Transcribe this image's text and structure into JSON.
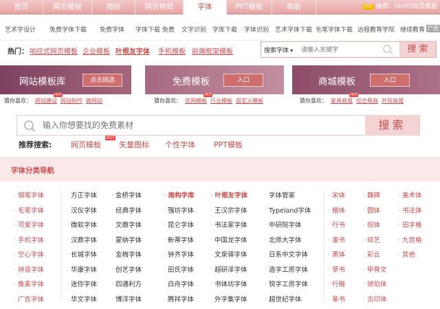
{
  "topnav": {
    "tabs": [
      "首页",
      "网页模板",
      "图标",
      "网页特效",
      "字体",
      "PPT模板",
      "帮助"
    ],
    "active": 4,
    "right_text": "推荐：html5网页模板",
    "right_hot": "HOT"
  },
  "subnav": {
    "items": [
      "艺术字设计",
      "免费字体下载",
      "免费字体",
      "字体下载 免费",
      "文字识别",
      "字库下载",
      "字体识别",
      "艺术字体下载",
      "毛笔字体下载",
      "远程教育学院",
      "继续教育"
    ],
    "ad": "广告"
  },
  "hotbar": {
    "label": "热门：",
    "links": [
      "响应式网页模板",
      "企业模板",
      "叶根友字体",
      "手机模板",
      "前端框架模板"
    ],
    "search_select": "搜索字体",
    "search_placeholder": "请输入关键字",
    "search_button": "搜 索"
  },
  "banners": [
    {
      "title": "网站模板库",
      "button": "点击挑选",
      "guess_label": "猜你喜欢：",
      "guess_links": [
        "网站建设",
        "网站制作",
        "做网站"
      ]
    },
    {
      "title": "免费模板",
      "button": "入口",
      "guess_label": "猜你喜欢：",
      "guess_links": [
        "官网模板",
        "行业模板",
        "自定义模板"
      ]
    },
    {
      "title": "商城模板",
      "button": "入口",
      "guess_label": "猜你喜欢：",
      "guess_links": [
        "家具商城",
        "综合电商",
        "外贸商城"
      ]
    }
  ],
  "big_search": {
    "placeholder": "输入你想要找的免费素材",
    "button": "搜索"
  },
  "recommend": {
    "label": "推荐搜索:",
    "links": [
      "网页模板",
      "矢量图标",
      "个性字体",
      "PPT模板"
    ],
    "hot": "HOT"
  },
  "category": {
    "title": "字体分类导航"
  },
  "columns": [
    {
      "color": "#c94c4c",
      "items": [
        "钢笔字体",
        "毛笔字体",
        "可爱字体",
        "手机字体",
        "空心字体",
        "拼音字体",
        "像素字体",
        "广告字体"
      ]
    },
    {
      "color": "#333333",
      "items": [
        "方正字体",
        "汉仪字体",
        "微软字体",
        "汉鼎字体",
        "长城字体",
        "华康字体",
        "迷你字体",
        "华文字体"
      ]
    },
    {
      "color": "#333333",
      "items": [
        "金桥字体",
        "经典字体",
        "文鼎字体",
        "蒙纳字体",
        "金梅字体",
        "创艺字体",
        "四通利方",
        "博洋字体"
      ]
    },
    {
      "color": "#333333",
      "items": [
        "南构字库",
        "强坊字体",
        "昆仑字体",
        "新蒂字体",
        "钟齐字体",
        "田氏字体",
        "白舟字体",
        "腾祥字体"
      ]
    },
    {
      "color": "#333333",
      "items": [
        "叶根友字体",
        "王汉宗字体",
        "书法家字体",
        "中国龙字体",
        "文泉驿字体",
        "超研泽字体",
        "书体坊字体",
        "外字集字体"
      ]
    },
    {
      "color": "#333333",
      "items": [
        "字体管家",
        "Typeland字体",
        "中研院字体",
        "北师大字体",
        "日系中文字体",
        "造字工房字体",
        "锐字工房字体",
        "超世纪字体"
      ]
    },
    {
      "color": "#c94c4c",
      "items": [
        "宋体",
        "楷体",
        "行书",
        "隶书",
        "黑体",
        "草书",
        "行楷",
        "篆书"
      ]
    },
    {
      "color": "#c94c4c",
      "items": [
        "魏碑",
        "圆体",
        "综体",
        "综艺",
        "彩云",
        "甲骨文",
        "琥珀体",
        "古印体"
      ]
    },
    {
      "color": "#c94c4c",
      "items": [
        "美术体",
        "书法体",
        "田字格",
        "九宫格",
        "其他"
      ]
    }
  ],
  "colors": {
    "accent": "#c94c4c",
    "nav": "#e7a3a3",
    "banner1": "#8a4c6e",
    "banner2": "#b4788f",
    "banner3": "#9c5c74"
  }
}
